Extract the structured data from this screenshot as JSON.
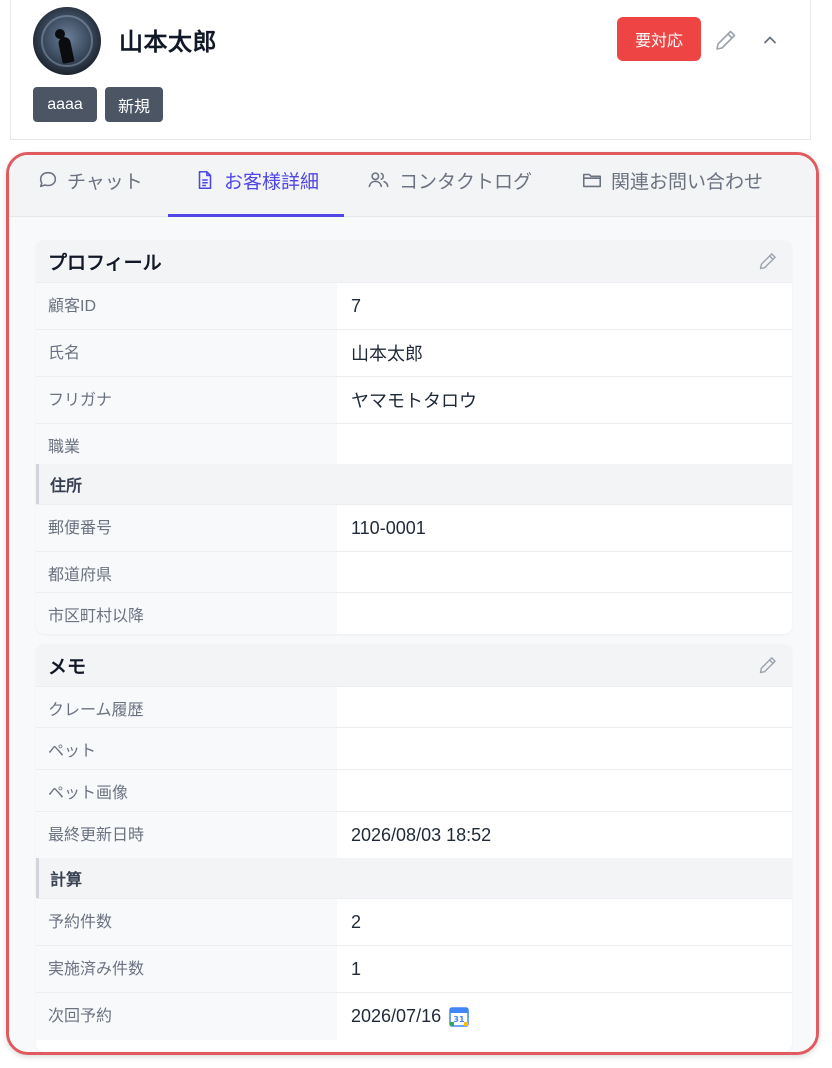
{
  "header": {
    "customer_name": "山本太郎",
    "status_button": "要対応",
    "tags": [
      "aaaa",
      "新規"
    ]
  },
  "tabs": [
    {
      "label": "チャット",
      "icon": "chat-icon",
      "active": false
    },
    {
      "label": "お客様詳細",
      "icon": "document-icon",
      "active": true
    },
    {
      "label": "コンタクトログ",
      "icon": "users-icon",
      "active": false
    },
    {
      "label": "関連お問い合わせ",
      "icon": "folder-icon",
      "active": false
    }
  ],
  "profile": {
    "title": "プロフィール",
    "rows": [
      {
        "label": "顧客ID",
        "value": "7"
      },
      {
        "label": "氏名",
        "value": "山本太郎"
      },
      {
        "label": "フリガナ",
        "value": "ヤマモトタロウ"
      },
      {
        "label": "職業",
        "value": ""
      }
    ],
    "address_group": "住所",
    "address_rows": [
      {
        "label": "郵便番号",
        "value": "110-0001"
      },
      {
        "label": "都道府県",
        "value": ""
      },
      {
        "label": "市区町村以降",
        "value": ""
      }
    ]
  },
  "memo": {
    "title": "メモ",
    "rows": [
      {
        "label": "クレーム履歴",
        "value": ""
      },
      {
        "label": "ペット",
        "value": ""
      },
      {
        "label": "ペット画像",
        "value": ""
      },
      {
        "label": "最終更新日時",
        "value": "2026/08/03 18:52"
      }
    ],
    "calc_group": "計算",
    "calc_rows": [
      {
        "label": "予約件数",
        "value": "2"
      },
      {
        "label": "実施済み件数",
        "value": "1"
      },
      {
        "label": "次回予約",
        "value": "2026/07/16"
      }
    ],
    "calendar_icon_text": "31"
  },
  "colors": {
    "accent": "#4f46e5",
    "status": "#ef4444",
    "tag": "#4b5563",
    "highlight_border": "#e05a5f"
  }
}
